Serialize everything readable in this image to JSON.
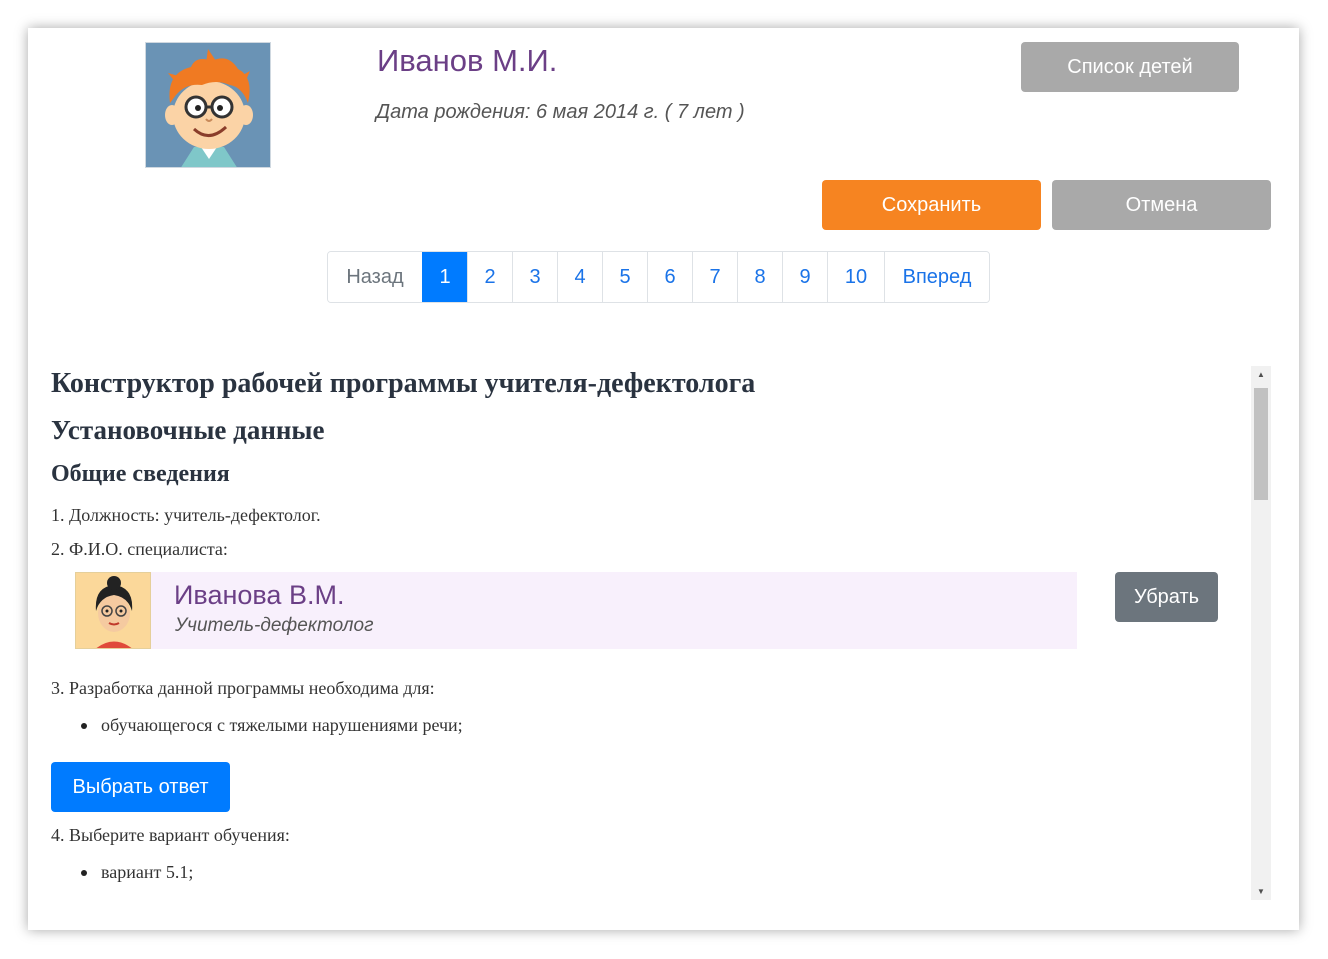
{
  "child": {
    "name": "Иванов М.И.",
    "dob": "Дата рождения: 6 мая 2014 г. ( 7 лет )"
  },
  "buttons": {
    "children_list": "Список детей",
    "save": "Сохранить",
    "cancel": "Отмена",
    "remove": "Убрать",
    "choose_answer": "Выбрать ответ"
  },
  "pagination": {
    "prev": "Назад",
    "next": "Вперед",
    "pages": [
      "1",
      "2",
      "3",
      "4",
      "5",
      "6",
      "7",
      "8",
      "9",
      "10"
    ],
    "active": "1"
  },
  "content": {
    "title": "Конструктор рабочей программы учителя-дефектолога",
    "section": "Установочные данные",
    "subsection": "Общие сведения",
    "item1": "1. Должность: учитель-дефектолог.",
    "item2": "2. Ф.И.О. специалиста:",
    "item3": "3. Разработка данной программы необходима для:",
    "item3_answer": "обучающегося с тяжелыми нарушениями речи;",
    "item4": "4. Выберите вариант обучения:",
    "item4_answer": "вариант 5.1;"
  },
  "specialist": {
    "name": "Иванова В.М.",
    "role": "Учитель-дефектолог"
  },
  "colors": {
    "accent_orange": "#f68421",
    "primary_blue": "#007bff",
    "gray_button": "#a9a9a9",
    "dark_gray_button": "#6c757d",
    "name_purple": "#6b3f86",
    "specialist_bg": "#f8f0fc"
  }
}
